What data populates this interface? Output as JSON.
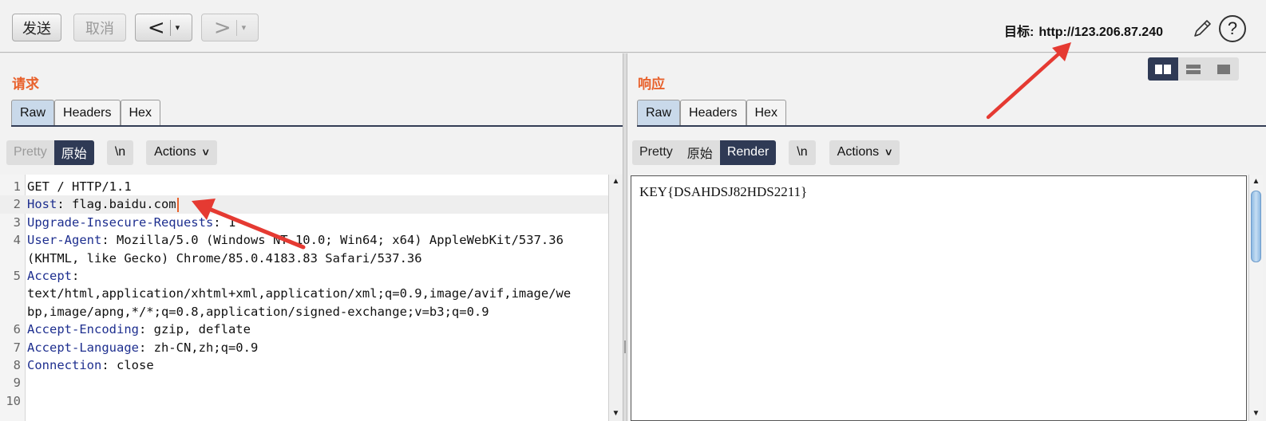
{
  "toolbar": {
    "send_label": "发送",
    "cancel_label": "取消",
    "back_glyph": "<",
    "forward_glyph": ">",
    "dropdown_glyph": "▾",
    "target_label": "目标:",
    "target_url": "http://123.206.87.240",
    "help_glyph": "?"
  },
  "request": {
    "title": "请求",
    "tabs": [
      {
        "label": "Raw",
        "active": true
      },
      {
        "label": "Headers",
        "active": false
      },
      {
        "label": "Hex",
        "active": false
      }
    ],
    "view_modes": [
      {
        "label": "Pretty",
        "state": "disabled"
      },
      {
        "label": "原始",
        "state": "active"
      }
    ],
    "newline_label": "\\n",
    "actions_label": "Actions",
    "lines": [
      {
        "num": "1",
        "key": "",
        "value": "GET / HTTP/1.1"
      },
      {
        "num": "2",
        "key": "Host",
        "value": ": flag.baidu.com"
      },
      {
        "num": "3",
        "key": "Upgrade-Insecure-Requests",
        "value": ": 1"
      },
      {
        "num": "4",
        "key": "User-Agent",
        "value": ": Mozilla/5.0 (Windows NT 10.0; Win64; x64) AppleWebKit/537.36"
      },
      {
        "num": "",
        "key": "",
        "value": "(KHTML, like Gecko) Chrome/85.0.4183.83 Safari/537.36"
      },
      {
        "num": "5",
        "key": "Accept",
        "value": ":"
      },
      {
        "num": "",
        "key": "",
        "value": "text/html,application/xhtml+xml,application/xml;q=0.9,image/avif,image/we"
      },
      {
        "num": "",
        "key": "",
        "value": "bp,image/apng,*/*;q=0.8,application/signed-exchange;v=b3;q=0.9"
      },
      {
        "num": "6",
        "key": "Accept-Encoding",
        "value": ": gzip, deflate"
      },
      {
        "num": "7",
        "key": "Accept-Language",
        "value": ": zh-CN,zh;q=0.9"
      },
      {
        "num": "8",
        "key": "Connection",
        "value": ": close"
      },
      {
        "num": "9",
        "key": "",
        "value": ""
      },
      {
        "num": "10",
        "key": "",
        "value": ""
      }
    ]
  },
  "response": {
    "title": "响应",
    "tabs": [
      {
        "label": "Raw",
        "active": true
      },
      {
        "label": "Headers",
        "active": false
      },
      {
        "label": "Hex",
        "active": false
      }
    ],
    "view_modes": [
      {
        "label": "Pretty",
        "state": "normal"
      },
      {
        "label": "原始",
        "state": "normal"
      },
      {
        "label": "Render",
        "state": "active"
      }
    ],
    "newline_label": "\\n",
    "actions_label": "Actions",
    "render_text": "KEY{DSAHDSJ82HDS2211}"
  },
  "layout_modes": [
    "side-by-side-icon",
    "stacked-icon",
    "single-icon"
  ],
  "colors": {
    "accent_orange": "#e8612c",
    "active_dark": "#2f3a55",
    "tab_active": "#c9d9ea",
    "header_key": "#1e2f8f",
    "annotation_red": "#e53a32"
  }
}
